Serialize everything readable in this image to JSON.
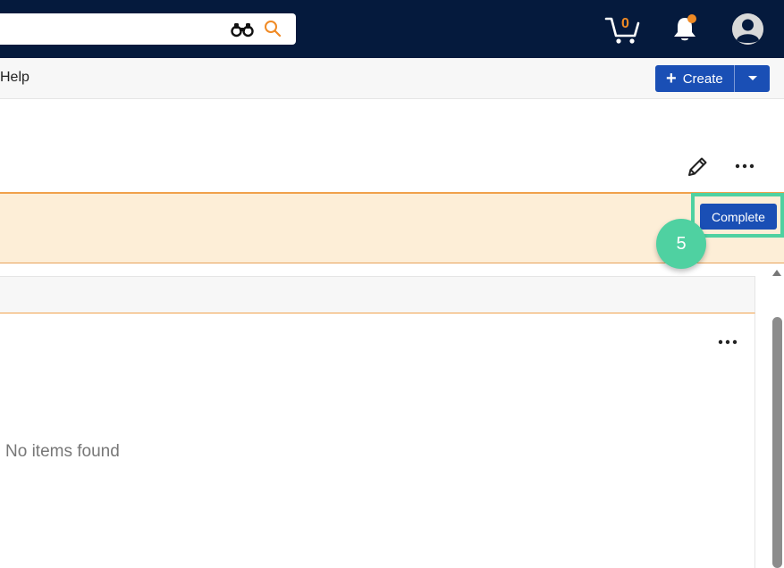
{
  "header": {
    "search": {
      "value": "",
      "placeholder": ""
    },
    "icons": {
      "binoculars": "binoculars-icon",
      "search": "search-icon",
      "cart": "cart-icon",
      "bell": "bell-icon",
      "avatar": "avatar-icon"
    },
    "cart_count": "0",
    "colors": {
      "background": "#051a3d",
      "accent": "#f08a24"
    }
  },
  "menubar": {
    "help_label": "Help",
    "create_label": "Create"
  },
  "banner": {
    "complete_label": "Complete",
    "color": "#fdeed7"
  },
  "annotation": {
    "step_number": "5",
    "color": "#4fd1a1"
  },
  "panel": {
    "empty_message": "No items found"
  }
}
